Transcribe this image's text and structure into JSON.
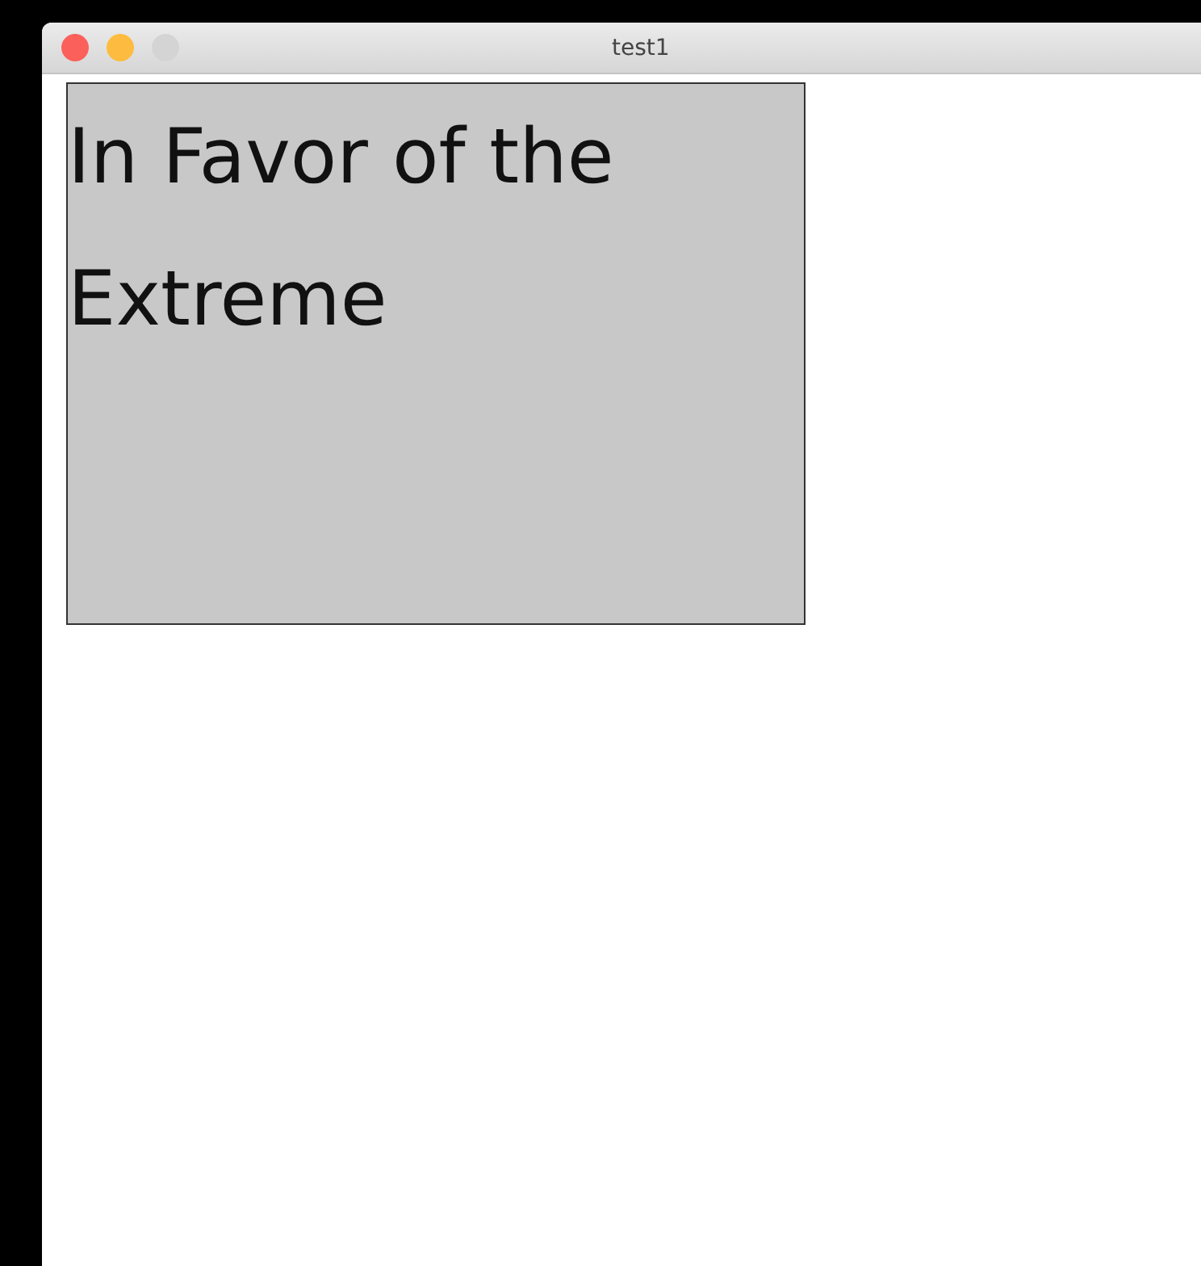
{
  "window": {
    "title": "test1",
    "controls": [
      {
        "color": "#fc605b"
      },
      {
        "color": "#fdbc40"
      },
      {
        "color": "#d4d4d4"
      }
    ]
  },
  "text_area": {
    "value": "In Favor of the Extreme"
  }
}
